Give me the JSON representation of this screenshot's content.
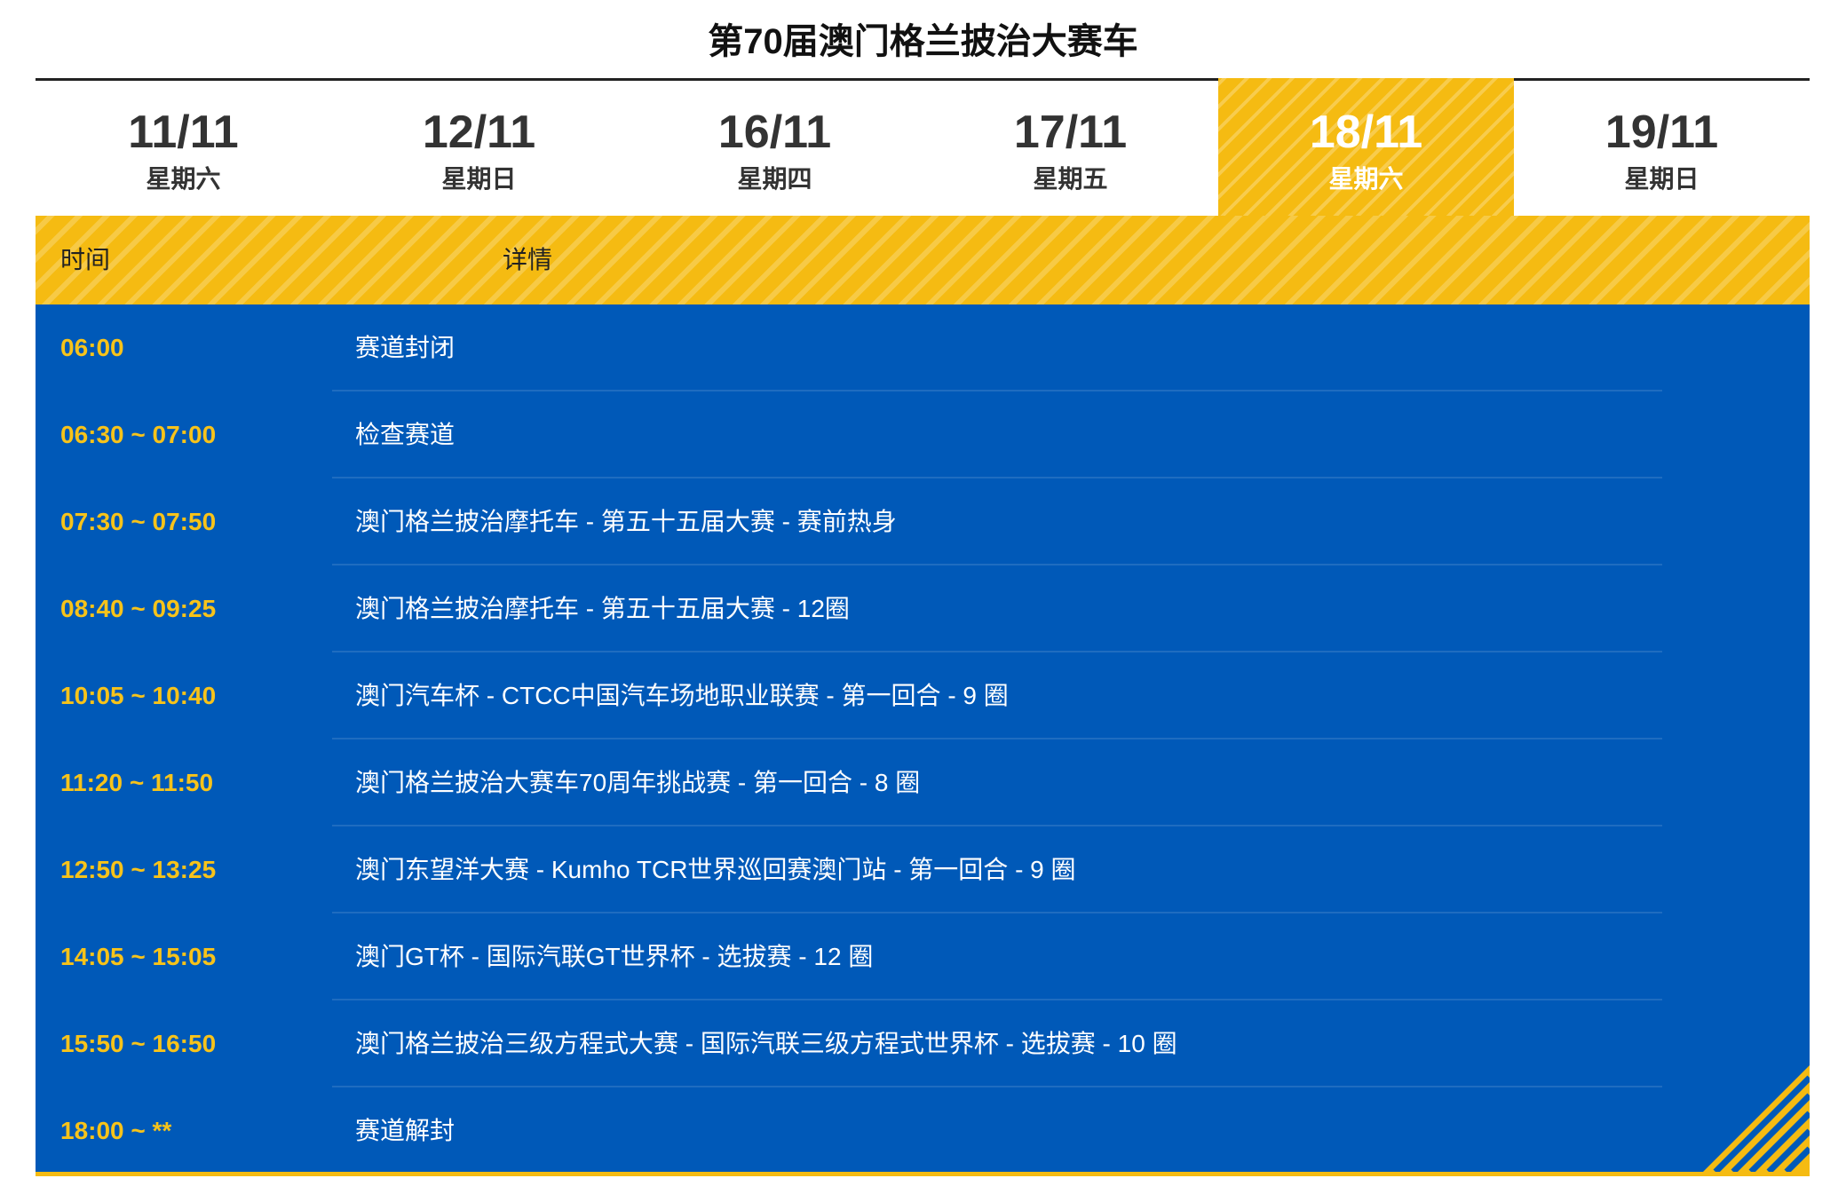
{
  "page_title": "第70届澳门格兰披治大赛车",
  "tabs": [
    {
      "date": "11/11",
      "weekday": "星期六",
      "active": false
    },
    {
      "date": "12/11",
      "weekday": "星期日",
      "active": false
    },
    {
      "date": "16/11",
      "weekday": "星期四",
      "active": false
    },
    {
      "date": "17/11",
      "weekday": "星期五",
      "active": false
    },
    {
      "date": "18/11",
      "weekday": "星期六",
      "active": true
    },
    {
      "date": "19/11",
      "weekday": "星期日",
      "active": false
    }
  ],
  "table_header": {
    "time": "时间",
    "detail": "详情"
  },
  "schedule": [
    {
      "time": "06:00",
      "detail": "赛道封闭"
    },
    {
      "time": "06:30 ~ 07:00",
      "detail": "检查赛道"
    },
    {
      "time": "07:30 ~ 07:50",
      "detail": "澳门格兰披治摩托车 - 第五十五届大赛 - 赛前热身"
    },
    {
      "time": "08:40 ~ 09:25",
      "detail": "澳门格兰披治摩托车 - 第五十五届大赛 - 12圈"
    },
    {
      "time": "10:05 ~ 10:40",
      "detail": "澳门汽车杯 - CTCC中国汽车场地职业联赛 - 第一回合 - 9 圈"
    },
    {
      "time": "11:20 ~ 11:50",
      "detail": "澳门格兰披治大赛车70周年挑战赛 - 第一回合 - 8 圈"
    },
    {
      "time": "12:50 ~ 13:25",
      "detail": "澳门东望洋大赛 - Kumho TCR世界巡回赛澳门站 - 第一回合 - 9 圈"
    },
    {
      "time": "14:05 ~ 15:05",
      "detail": "澳门GT杯 - 国际汽联GT世界杯 - 选拔赛 - 12 圈"
    },
    {
      "time": "15:50 ~ 16:50",
      "detail": "澳门格兰披治三级方程式大赛 - 国际汽联三级方程式世界杯 - 选拔赛 - 10 圈"
    },
    {
      "time": "18:00 ~ **",
      "detail": "赛道解封"
    }
  ],
  "colors": {
    "accent_yellow": "#f5bb12",
    "schedule_blue": "#0059b8",
    "time_text": "#f7c31a"
  }
}
